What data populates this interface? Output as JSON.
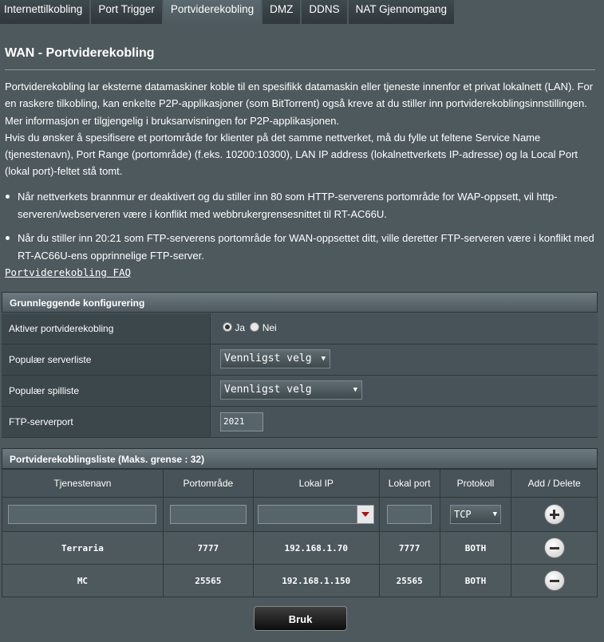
{
  "tabs": [
    "Internettilkobling",
    "Port Trigger",
    "Portviderekobling",
    "DMZ",
    "DDNS",
    "NAT Gjennomgang"
  ],
  "active_tab": "Portviderekobling",
  "page_title": "WAN - Portviderekobling",
  "description": [
    "Portviderekobling lar eksterne datamaskiner koble til en spesifikk datamaskin eller tjeneste innenfor et privat lokalnett (LAN). For en raskere tilkobling, kan enkelte P2P-applikasjoner (som BitTorrent) også kreve at du stiller inn portviderekoblingsinnstillingen. Mer informasjon er tilgjengelig i bruksanvisningen for P2P-applikasjonen.",
    "Hvis du ønsker å spesifisere et portområde for klienter på det samme nettverket, må du fylle ut feltene Service Name (tjenestenavn), Port Range (portområde) (f.eks. 10200:10300), LAN IP address (lokalnettverkets IP-adresse) og la Local Port (lokal port)-feltet stå tomt."
  ],
  "bullets": [
    "Når nettverkets brannmur er deaktivert og du stiller inn 80 som HTTP-serverens portområde for WAP-oppsett, vil http-serveren/webserveren være i konflikt med webbrukergrensesnittet til RT-AC66U.",
    "Når du stiller inn 20:21 som FTP-serverens portområde for WAN-oppsettet ditt, ville deretter FTP-serveren være i konflikt med RT-AC66U-ens opprinnelige FTP-server."
  ],
  "faq_link": "Portviderekobling FAQ",
  "basic_config": {
    "header": "Grunnleggende konfigurering",
    "enable_label": "Aktiver portviderekobling",
    "radio_yes": "Ja",
    "radio_no": "Nei",
    "enable_value": "Ja",
    "server_list_label": "Populær serverliste",
    "server_list_value": "Vennligst velg",
    "game_list_label": "Populær spilliste",
    "game_list_value": "Vennligst velg",
    "ftp_port_label": "FTP-serverport",
    "ftp_port_value": "2021"
  },
  "forward_list": {
    "header": "Portviderekoblingsliste (Maks. grense : 32)",
    "columns": [
      "Tjenestenavn",
      "Portområde",
      "Lokal IP",
      "Lokal port",
      "Protokoll",
      "Add / Delete"
    ],
    "protocol_default": "TCP",
    "rows": [
      {
        "name": "Terraria",
        "port_range": "7777",
        "local_ip": "192.168.1.70",
        "local_port": "7777",
        "protocol": "BOTH"
      },
      {
        "name": "MC",
        "port_range": "25565",
        "local_ip": "192.168.1.150",
        "local_port": "25565",
        "protocol": "BOTH"
      }
    ]
  },
  "apply_button": "Bruk"
}
